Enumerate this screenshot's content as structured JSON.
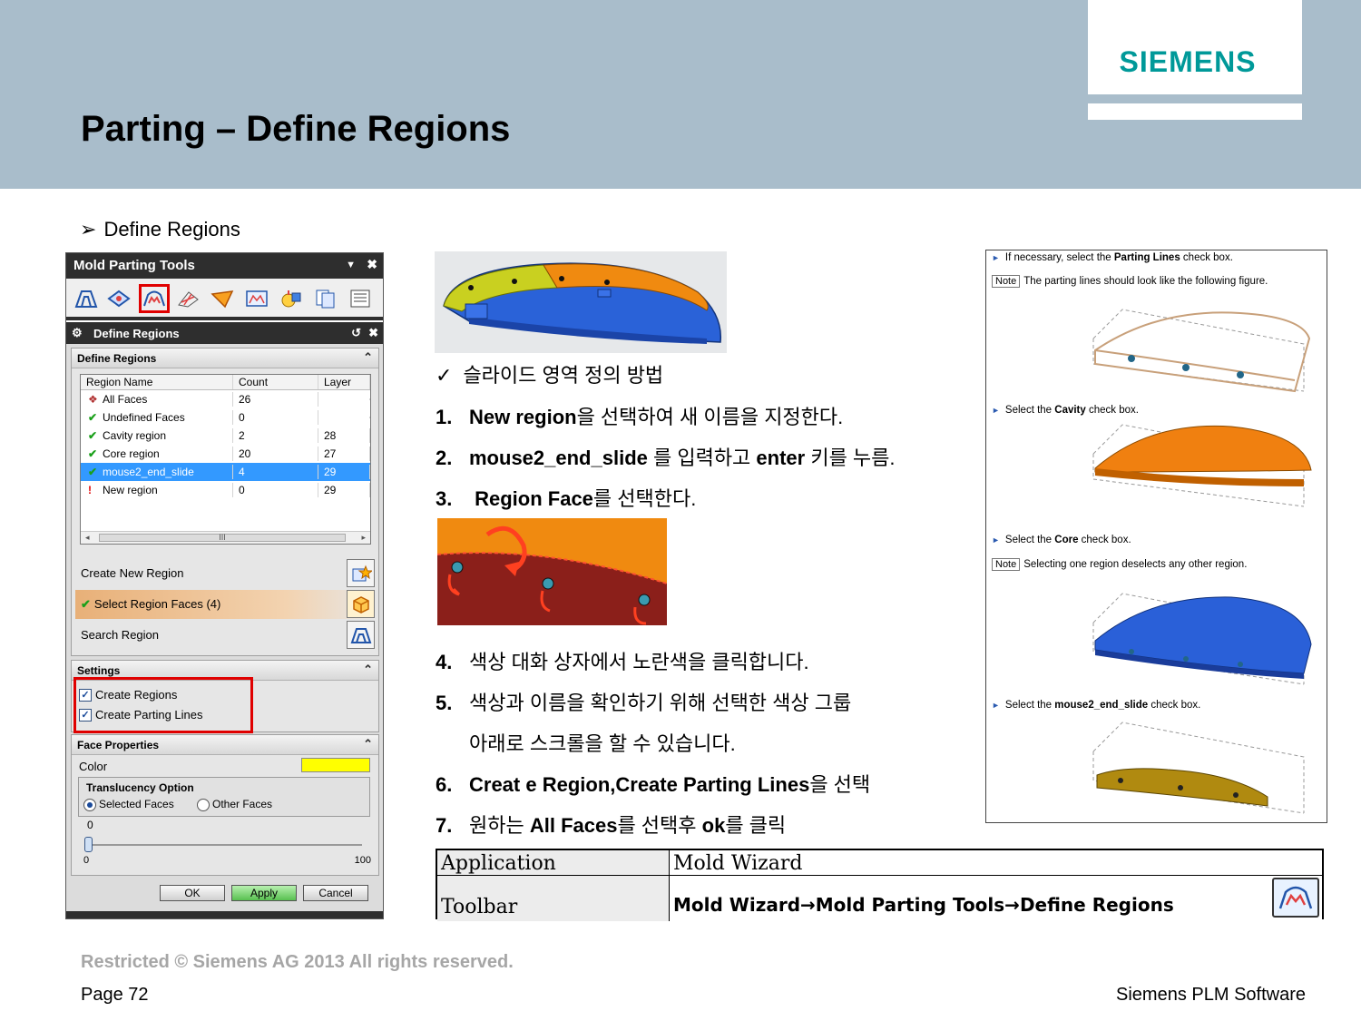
{
  "header": {
    "logo": "SIEMENS",
    "title": "Parting – Define Regions"
  },
  "bullet": {
    "arrow": "➢",
    "text": "Define Regions"
  },
  "dialog": {
    "title": "Mold Parting Tools",
    "toolbar_icons": [
      "region-analysis-icon",
      "design-parting-surface-icon",
      "define-regions-icon",
      "edit-patch-surface-icon",
      "design-parting-surface-icon",
      "define-cavity-core-icon",
      "exchange-model-icon",
      "backup-parting-icon",
      "parting-navigator-icon"
    ],
    "sub_title": "Define Regions",
    "define_regions_group": "Define Regions",
    "table": {
      "columns": [
        "Region Name",
        "Count",
        "Layer"
      ],
      "rows": [
        {
          "name": "All Faces",
          "count": "26",
          "layer": "",
          "status": "all"
        },
        {
          "name": "Undefined Faces",
          "count": "0",
          "layer": "",
          "status": "ok"
        },
        {
          "name": "Cavity region",
          "count": "2",
          "layer": "28",
          "status": "ok"
        },
        {
          "name": "Core region",
          "count": "20",
          "layer": "27",
          "status": "ok"
        },
        {
          "name": "mouse2_end_slide",
          "count": "4",
          "layer": "29",
          "status": "ok",
          "selected": true
        },
        {
          "name": "New region",
          "count": "0",
          "layer": "29",
          "status": "bad"
        }
      ],
      "scroll_label": "III"
    },
    "create_new_region": "Create New Region",
    "select_region_faces": "Select Region Faces (4)",
    "search_region": "Search Region",
    "settings_group": "Settings",
    "create_regions": "Create Regions",
    "create_parting_lines": "Create Parting Lines",
    "create_regions_checked": true,
    "create_parting_lines_checked": true,
    "face_properties_group": "Face Properties",
    "color_label": "Color",
    "color_value": "#ffff00",
    "translucency_label": "Translucency Option",
    "selected_faces": "Selected Faces",
    "other_faces": "Other Faces",
    "slider_value": "0",
    "slider_min": "0",
    "slider_max": "100",
    "ok_label": "OK",
    "apply_label": "Apply",
    "cancel_label": "Cancel"
  },
  "steps": {
    "subhead_check": "✓",
    "subhead": "슬라이드 영역 정의  방법",
    "s1_num": "1.",
    "s1_bold": "New  region",
    "s1_rest": "을 선택하여 새 이름을  지정한다.",
    "s2_num": "2.",
    "s2_bold": "mouse2_end_slide",
    "s2_mid": " 를 입력하고 ",
    "s2_bold2": "enter",
    "s2_rest": " 키를 누름.",
    "s3_num": "3.",
    "s3_bold": " Region Face",
    "s3_rest": "를 선택한다.",
    "s4_num": "4.",
    "s4_text": "색상 대화 상자에서 노란색을  클릭합니다.",
    "s5_num": "5.",
    "s5_text": "색상과 이름을 확인하기 위해  선택한 색상 그룹",
    "s5_text2": "아래로 스크롤을 할 수 있습니다.",
    "s6_num": "6.",
    "s6_bold": "Creat e Region,Create Parting Lines",
    "s6_rest": "을 선택",
    "s7_num": "7.",
    "s7_pre": "원하는 ",
    "s7_bold": "All Faces",
    "s7_mid": "를 선택후 ",
    "s7_bold2": "ok",
    "s7_rest": "를 클릭"
  },
  "reference": {
    "l1_pre": "If necessary, select the ",
    "l1_bold": "Parting Lines",
    "l1_post": " check box.",
    "note_tag": "Note",
    "l2": "The parting lines should look like the following figure.",
    "l3_pre": "Select the ",
    "l3_bold": "Cavity",
    "l3_post": " check box.",
    "l4_pre": "Select the ",
    "l4_bold": "Core",
    "l4_post": " check box.",
    "l5": "Selecting one region deselects any other region.",
    "l6_pre": "Select the ",
    "l6_bold": "mouse2_end_slide",
    "l6_post": " check box.",
    "colors": {
      "outline": "#c8a07a",
      "cavity": "#f08010",
      "core": "#2a60d8",
      "slide": "#b08a10"
    }
  },
  "bottom_table": {
    "row1_label": "Application",
    "row1_value": "Mold Wizard",
    "row2_label": "Toolbar",
    "row2_value": "Mold Wizard→Mold Parting Tools→Define Regions",
    "row2_icon": "define-regions-icon"
  },
  "footer": {
    "copyright": "Restricted © Siemens AG 2013 All rights reserved.",
    "page": "Page 72",
    "brand": "Siemens PLM Software"
  }
}
